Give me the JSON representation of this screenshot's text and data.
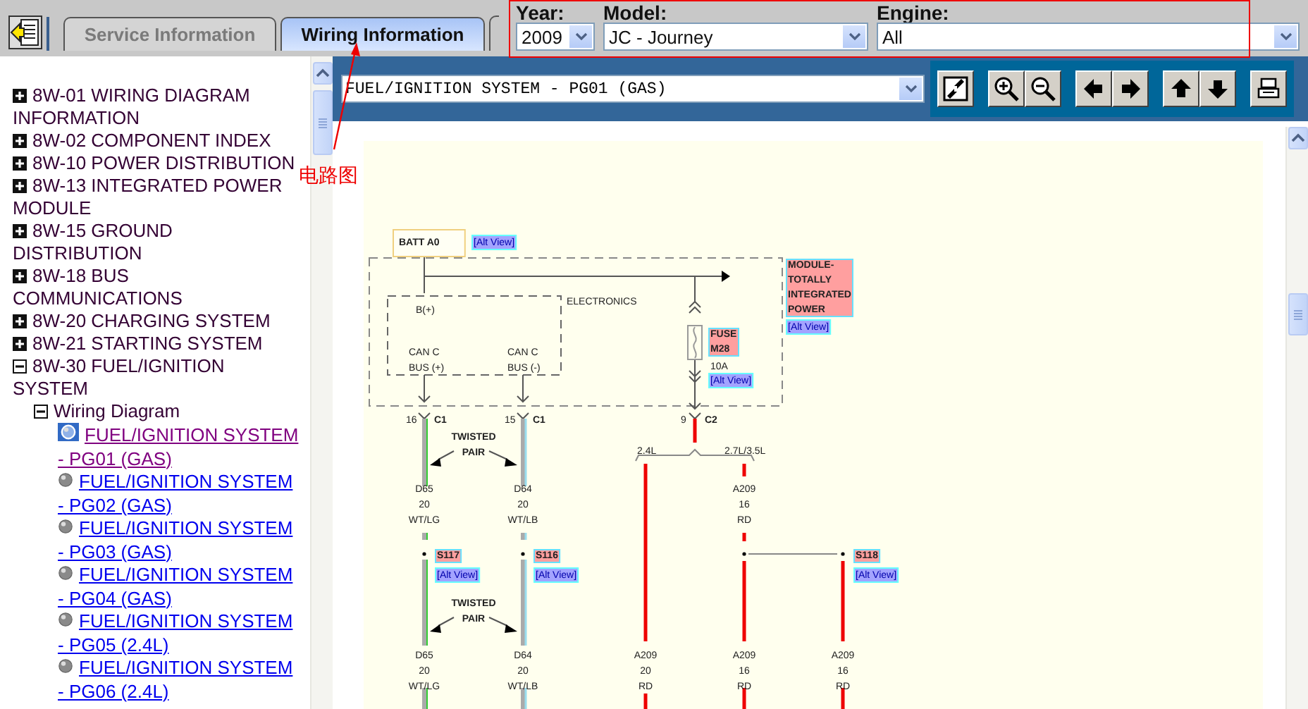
{
  "tabs": [
    {
      "label": "Service Information",
      "selected": false
    },
    {
      "label": "Wiring Information",
      "selected": true
    }
  ],
  "filters": [
    {
      "label": "Year:",
      "value": "2009"
    },
    {
      "label": "Model:",
      "value": "JC - Journey"
    },
    {
      "label": "Engine:",
      "value": "All"
    }
  ],
  "annotation": {
    "text": "电路图"
  },
  "tree": [
    {
      "kind": "folder",
      "label": "8W-01 WIRING DIAGRAM INFORMATION",
      "expanded": false
    },
    {
      "kind": "folder",
      "label": "8W-02 COMPONENT INDEX",
      "expanded": false
    },
    {
      "kind": "folder",
      "label": "8W-10 POWER DISTRIBUTION",
      "expanded": false
    },
    {
      "kind": "folder",
      "label": "8W-13 INTEGRATED POWER MODULE",
      "expanded": false
    },
    {
      "kind": "folder",
      "label": "8W-15 GROUND DISTRIBUTION",
      "expanded": false
    },
    {
      "kind": "folder",
      "label": "8W-18 BUS COMMUNICATIONS",
      "expanded": false
    },
    {
      "kind": "folder",
      "label": "8W-20 CHARGING SYSTEM",
      "expanded": false
    },
    {
      "kind": "folder",
      "label": "8W-21 STARTING SYSTEM",
      "expanded": false
    },
    {
      "kind": "folder",
      "label": "8W-30 FUEL/IGNITION SYSTEM",
      "expanded": true,
      "children": [
        {
          "kind": "folder",
          "label": "Wiring Diagram",
          "expanded": true,
          "children": [
            {
              "kind": "page",
              "label": "FUEL/IGNITION SYSTEM - PG01 (GAS)",
              "selected": true
            },
            {
              "kind": "page",
              "label": "FUEL/IGNITION SYSTEM - PG02 (GAS)",
              "selected": false
            },
            {
              "kind": "page",
              "label": "FUEL/IGNITION SYSTEM - PG03 (GAS)",
              "selected": false
            },
            {
              "kind": "page",
              "label": "FUEL/IGNITION SYSTEM - PG04 (GAS)",
              "selected": false
            },
            {
              "kind": "page",
              "label": "FUEL/IGNITION SYSTEM - PG05 (2.4L)",
              "selected": false
            },
            {
              "kind": "page",
              "label": "FUEL/IGNITION SYSTEM - PG06 (2.4L)",
              "selected": false
            }
          ]
        }
      ]
    }
  ],
  "toolbar": {
    "page_select": "FUEL/IGNITION SYSTEM - PG01 (GAS)"
  },
  "diagram": {
    "labels": [
      {
        "kind": "battery",
        "lines": [
          "BATT A0"
        ]
      },
      {
        "kind": "link",
        "lines": [
          "[Alt View]"
        ]
      },
      {
        "kind": "plain",
        "lines": [
          "ELECTRONICS"
        ]
      },
      {
        "kind": "plain",
        "lines": [
          "B(+)"
        ]
      },
      {
        "kind": "plain",
        "lines": [
          "CAN C",
          "BUS (+)"
        ]
      },
      {
        "kind": "plain",
        "lines": [
          "CAN C",
          "BUS (-)"
        ]
      },
      {
        "kind": "tag",
        "lines": [
          "MODULE-",
          "TOTALLY",
          "INTEGRATED",
          "POWER"
        ]
      },
      {
        "kind": "link",
        "lines": [
          "[Alt View]"
        ]
      },
      {
        "kind": "tag",
        "lines": [
          "FUSE",
          "M28"
        ]
      },
      {
        "kind": "plain",
        "lines": [
          "10A"
        ]
      },
      {
        "kind": "link",
        "lines": [
          "[Alt View]"
        ]
      },
      {
        "kind": "plain",
        "lines": [
          "16"
        ]
      },
      {
        "kind": "bold",
        "lines": [
          "C1"
        ]
      },
      {
        "kind": "plain",
        "lines": [
          "15"
        ]
      },
      {
        "kind": "bold",
        "lines": [
          "C1"
        ]
      },
      {
        "kind": "plain",
        "lines": [
          "9"
        ]
      },
      {
        "kind": "bold",
        "lines": [
          "C2"
        ]
      },
      {
        "kind": "bold",
        "lines": [
          "TWISTED",
          "PAIR"
        ]
      },
      {
        "kind": "plain",
        "lines": [
          "2.4L"
        ]
      },
      {
        "kind": "plain",
        "lines": [
          "2.7L/3.5L"
        ]
      },
      {
        "kind": "plain",
        "lines": [
          "D65",
          "20",
          "WT/LG"
        ]
      },
      {
        "kind": "plain",
        "lines": [
          "D64",
          "20",
          "WT/LB"
        ]
      },
      {
        "kind": "plain",
        "lines": [
          "A209",
          "16",
          "RD"
        ]
      },
      {
        "kind": "tag",
        "lines": [
          "S117"
        ]
      },
      {
        "kind": "link",
        "lines": [
          "[Alt View]"
        ]
      },
      {
        "kind": "tag",
        "lines": [
          "S116"
        ]
      },
      {
        "kind": "link",
        "lines": [
          "[Alt View]"
        ]
      },
      {
        "kind": "tag",
        "lines": [
          "S118"
        ]
      },
      {
        "kind": "link",
        "lines": [
          "[Alt View]"
        ]
      },
      {
        "kind": "bold",
        "lines": [
          "TWISTED",
          "PAIR"
        ]
      },
      {
        "kind": "plain",
        "lines": [
          "D65",
          "20",
          "WT/LG"
        ]
      },
      {
        "kind": "plain",
        "lines": [
          "D64",
          "20",
          "WT/LB"
        ]
      },
      {
        "kind": "plain",
        "lines": [
          "A209",
          "20",
          "RD"
        ]
      },
      {
        "kind": "plain",
        "lines": [
          "A209",
          "16",
          "RD"
        ]
      },
      {
        "kind": "plain",
        "lines": [
          "A209",
          "16",
          "RD"
        ]
      }
    ]
  }
}
